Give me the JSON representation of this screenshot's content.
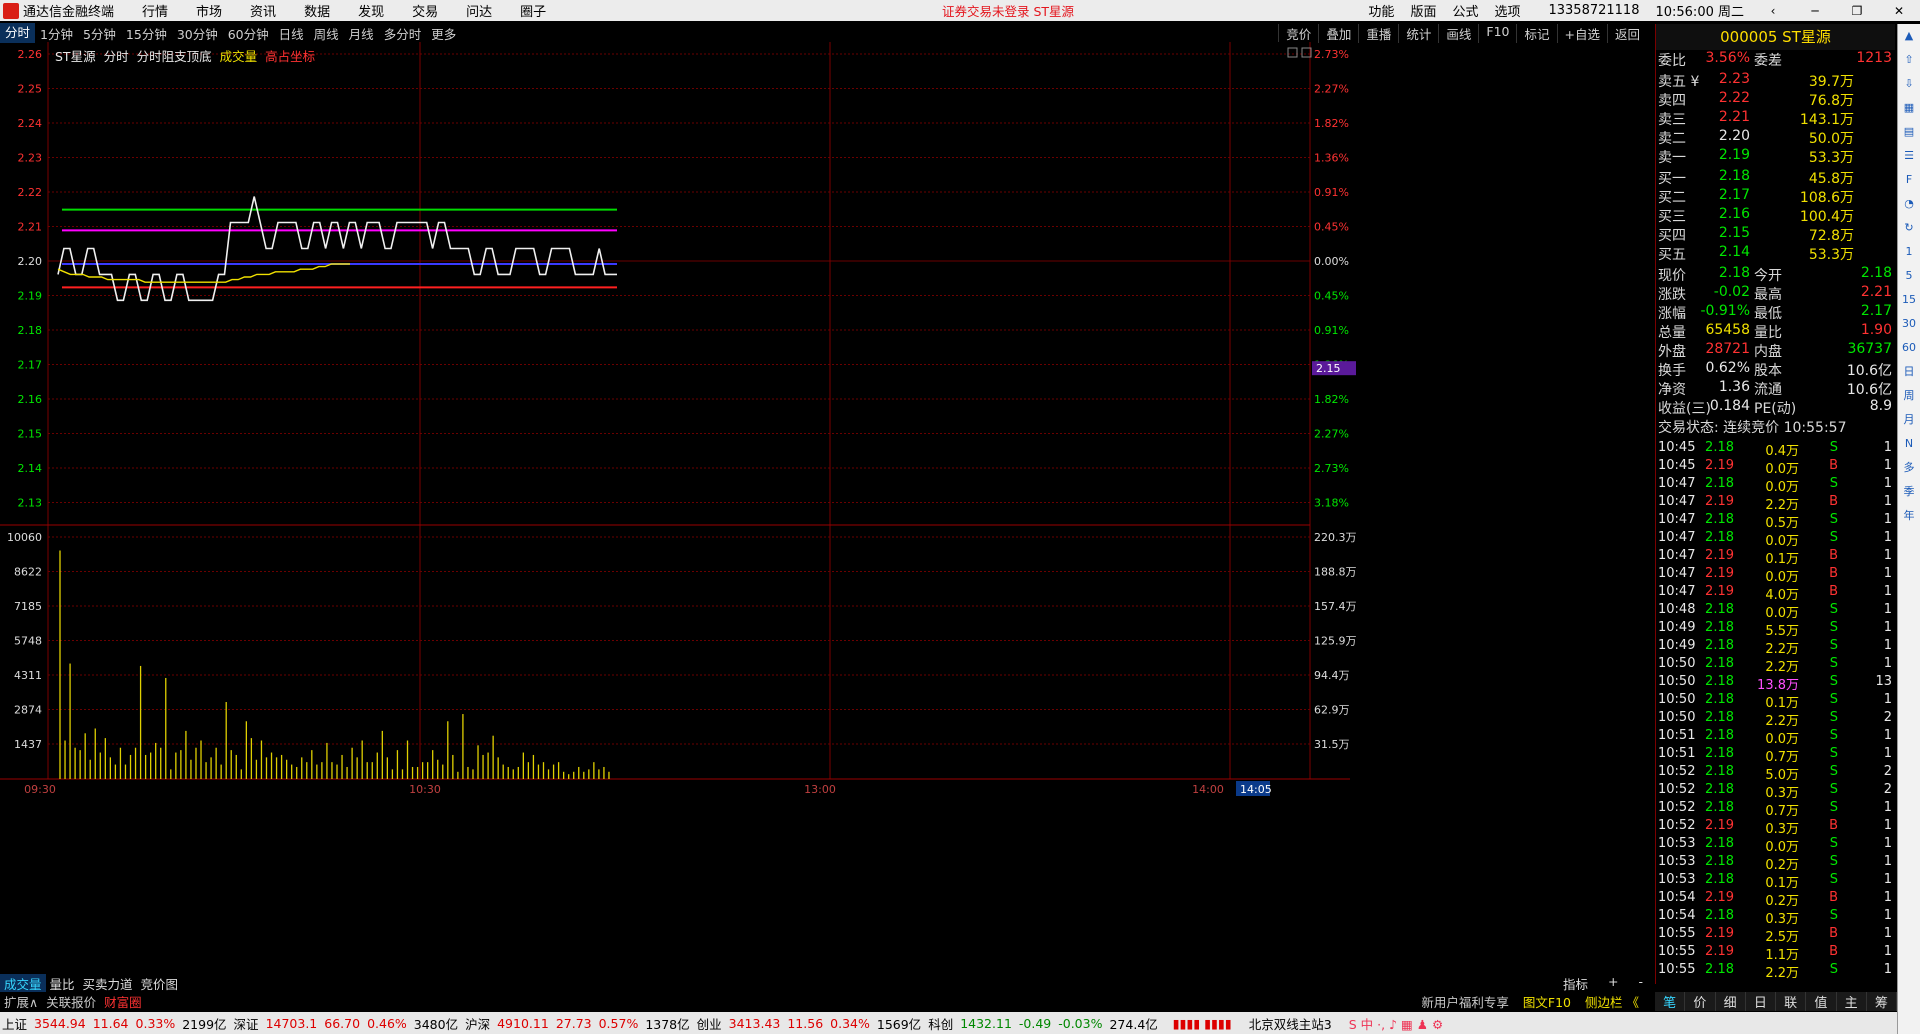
{
  "menubar": {
    "app_name": "通达信金融终端",
    "items": [
      "行情",
      "市场",
      "资讯",
      "数据",
      "发现",
      "交易",
      "问达",
      "圈子"
    ],
    "notice": "证券交易未登录 ST星源",
    "right": [
      "功能",
      "版面",
      "公式",
      "选项"
    ],
    "phone": "13358721118",
    "time": "10:56:00 周二"
  },
  "tabs": [
    "分时",
    "1分钟",
    "5分钟",
    "15分钟",
    "30分钟",
    "60分钟",
    "日线",
    "周线",
    "月线",
    "多分时",
    "更多"
  ],
  "tabs_right": [
    "竞价",
    "叠加",
    "重播",
    "统计",
    "画线",
    "F10",
    "标记",
    "+自选",
    "返回"
  ],
  "info": {
    "name": "ST星源",
    "items": [
      "分时",
      "分时阻支顶底",
      "成交量",
      "高占坐标"
    ]
  },
  "chart_data": {
    "type": "line",
    "title": "ST星源 分时",
    "price_ticks": [
      "2.26",
      "2.25",
      "2.24",
      "2.23",
      "2.22",
      "2.21",
      "2.20",
      "2.19",
      "2.18",
      "2.17",
      "2.16",
      "2.15",
      "2.14",
      "2.13"
    ],
    "pct_ticks": [
      "2.73%",
      "2.27%",
      "1.82%",
      "1.36%",
      "0.91%",
      "0.45%",
      "0.00%",
      "0.45%",
      "0.91%",
      "1.36%",
      "1.82%",
      "2.27%",
      "2.73%",
      "3.18%"
    ],
    "vol_ticks_left": [
      "10060",
      "8622",
      "7185",
      "5748",
      "4311",
      "2874",
      "1437"
    ],
    "vol_ticks_right": [
      "220.3万",
      "188.8万",
      "157.4万",
      "125.9万",
      "94.4万",
      "62.9万",
      "31.5万"
    ],
    "x_ticks": [
      "09:30",
      "10:30",
      "13:00",
      "14:00",
      "14:05"
    ],
    "cursor_price": "2.15",
    "ylim": [
      2.12,
      2.26
    ],
    "levels": {
      "green": 2.205,
      "magenta": 2.197,
      "blue": 2.184,
      "red": 2.175
    },
    "price_series": [
      2.18,
      2.19,
      2.19,
      2.18,
      2.18,
      2.19,
      2.19,
      2.18,
      2.18,
      2.18,
      2.17,
      2.17,
      2.18,
      2.18,
      2.17,
      2.17,
      2.18,
      2.18,
      2.17,
      2.17,
      2.18,
      2.18,
      2.17,
      2.17,
      2.17,
      2.17,
      2.17,
      2.18,
      2.18,
      2.2,
      2.2,
      2.2,
      2.2,
      2.21,
      2.2,
      2.19,
      2.19,
      2.2,
      2.2,
      2.2,
      2.2,
      2.19,
      2.19,
      2.2,
      2.2,
      2.19,
      2.2,
      2.2,
      2.19,
      2.2,
      2.2,
      2.19,
      2.2,
      2.2,
      2.2,
      2.19,
      2.19,
      2.2,
      2.2,
      2.2,
      2.2,
      2.2,
      2.2,
      2.19,
      2.2,
      2.2,
      2.19,
      2.19,
      2.19,
      2.19,
      2.18,
      2.18,
      2.19,
      2.19,
      2.18,
      2.18,
      2.18,
      2.19,
      2.19,
      2.19,
      2.19,
      2.18,
      2.18,
      2.19,
      2.19,
      2.19,
      2.19,
      2.18,
      2.18,
      2.18,
      2.18,
      2.19,
      2.18,
      2.18,
      2.18
    ],
    "avg_series": [
      2.182,
      2.181,
      2.18,
      2.18,
      2.18,
      2.179,
      2.179,
      2.179,
      2.178,
      2.178,
      2.178,
      2.178,
      2.178,
      2.178,
      2.177,
      2.177,
      2.177,
      2.177,
      2.177,
      2.177,
      2.177,
      2.177,
      2.177,
      2.177,
      2.177,
      2.177,
      2.177,
      2.177,
      2.178,
      2.178,
      2.179,
      2.179,
      2.18,
      2.18,
      2.18,
      2.181,
      2.181,
      2.181,
      2.181,
      2.182,
      2.182,
      2.182,
      2.183,
      2.183,
      2.184,
      2.184,
      2.184,
      2.184
    ],
    "volume_series": [
      9500,
      1600,
      4800,
      1300,
      1200,
      1900,
      800,
      2100,
      1100,
      1700,
      900,
      600,
      1300,
      600,
      1000,
      1300,
      4700,
      1000,
      1100,
      1500,
      1300,
      4200,
      400,
      1100,
      1200,
      2000,
      800,
      1300,
      1600,
      700,
      900,
      1300,
      600,
      3200,
      1200,
      1000,
      400,
      2400,
      1700,
      800,
      1600,
      900,
      1100,
      900,
      1000,
      800,
      600,
      500,
      900,
      700,
      1200,
      600,
      700,
      1500,
      700,
      600,
      1000,
      500,
      1300,
      900,
      1600,
      700,
      700,
      1100,
      2000,
      900,
      400,
      1200,
      400,
      1600,
      500,
      500,
      700,
      700,
      1200,
      800,
      600,
      2400,
      1000,
      300,
      2700,
      500,
      400,
      1400,
      1000,
      1100,
      1800,
      900,
      600,
      500,
      400,
      500,
      1100,
      700,
      1000,
      600,
      700,
      400,
      600,
      700,
      300,
      200,
      300,
      500,
      300,
      400,
      700,
      400,
      500,
      300
    ]
  },
  "quote": {
    "title": "000005 ST星源",
    "weibi_label": "委比",
    "weibi": "3.56%",
    "weicha_label": "委差",
    "weicha": "1213",
    "asks": [
      {
        "label": "卖五 ¥",
        "price": "2.23",
        "vol": "39.7万"
      },
      {
        "label": "卖四",
        "price": "2.22",
        "vol": "76.8万"
      },
      {
        "label": "卖三",
        "price": "2.21",
        "vol": "143.1万"
      },
      {
        "label": "卖二",
        "price": "2.20",
        "vol": "50.0万"
      },
      {
        "label": "卖一",
        "price": "2.19",
        "vol": "53.3万"
      }
    ],
    "bids": [
      {
        "label": "买一",
        "price": "2.18",
        "vol": "45.8万"
      },
      {
        "label": "买二",
        "price": "2.17",
        "vol": "108.6万"
      },
      {
        "label": "买三",
        "price": "2.16",
        "vol": "100.4万"
      },
      {
        "label": "买四",
        "price": "2.15",
        "vol": "72.8万"
      },
      {
        "label": "买五",
        "price": "2.14",
        "vol": "53.3万"
      }
    ],
    "stats": [
      {
        "l1": "现价",
        "v1": "2.18",
        "c1": "green",
        "l2": "今开",
        "v2": "2.18",
        "c2": "green"
      },
      {
        "l1": "涨跌",
        "v1": "-0.02",
        "c1": "green",
        "l2": "最高",
        "v2": "2.21",
        "c2": "red"
      },
      {
        "l1": "涨幅",
        "v1": "-0.91%",
        "c1": "green",
        "l2": "最低",
        "v2": "2.17",
        "c2": "green"
      },
      {
        "l1": "总量",
        "v1": "65458",
        "c1": "yellow",
        "l2": "量比",
        "v2": "1.90",
        "c2": "red"
      },
      {
        "l1": "外盘",
        "v1": "28721",
        "c1": "red",
        "l2": "内盘",
        "v2": "36737",
        "c2": "green"
      },
      {
        "l1": "换手",
        "v1": "0.62%",
        "c1": "white",
        "l2": "股本",
        "v2": "10.6亿",
        "c2": "white"
      },
      {
        "l1": "净资",
        "v1": "1.36",
        "c1": "white",
        "l2": "流通",
        "v2": "10.6亿",
        "c2": "white"
      },
      {
        "l1": "收益(三)",
        "v1": "0.184",
        "c1": "white",
        "l2": "PE(动)",
        "v2": "8.9",
        "c2": "white"
      }
    ],
    "trade_status": "交易状态: 连续竞价 10:55:57",
    "ticks": [
      [
        "10:45",
        "2.18",
        "0.4万",
        "S",
        "1"
      ],
      [
        "10:45",
        "2.19",
        "0.0万",
        "B",
        "1"
      ],
      [
        "10:47",
        "2.18",
        "0.0万",
        "S",
        "1"
      ],
      [
        "10:47",
        "2.19",
        "2.2万",
        "B",
        "1"
      ],
      [
        "10:47",
        "2.18",
        "0.5万",
        "S",
        "1"
      ],
      [
        "10:47",
        "2.18",
        "0.0万",
        "S",
        "1"
      ],
      [
        "10:47",
        "2.19",
        "0.1万",
        "B",
        "1"
      ],
      [
        "10:47",
        "2.19",
        "0.0万",
        "B",
        "1"
      ],
      [
        "10:47",
        "2.19",
        "4.0万",
        "B",
        "1"
      ],
      [
        "10:48",
        "2.18",
        "0.0万",
        "S",
        "1"
      ],
      [
        "10:49",
        "2.18",
        "5.5万",
        "S",
        "1"
      ],
      [
        "10:49",
        "2.18",
        "2.2万",
        "S",
        "1"
      ],
      [
        "10:50",
        "2.18",
        "2.2万",
        "S",
        "1"
      ],
      [
        "10:50",
        "2.18",
        "13.8万",
        "S",
        "13"
      ],
      [
        "10:50",
        "2.18",
        "0.1万",
        "S",
        "1"
      ],
      [
        "10:50",
        "2.18",
        "2.2万",
        "S",
        "2"
      ],
      [
        "10:51",
        "2.18",
        "0.0万",
        "S",
        "1"
      ],
      [
        "10:51",
        "2.18",
        "0.7万",
        "S",
        "1"
      ],
      [
        "10:52",
        "2.18",
        "5.0万",
        "S",
        "2"
      ],
      [
        "10:52",
        "2.18",
        "0.3万",
        "S",
        "2"
      ],
      [
        "10:52",
        "2.18",
        "0.7万",
        "S",
        "1"
      ],
      [
        "10:52",
        "2.19",
        "0.3万",
        "B",
        "1"
      ],
      [
        "10:53",
        "2.18",
        "0.0万",
        "S",
        "1"
      ],
      [
        "10:53",
        "2.18",
        "0.2万",
        "S",
        "1"
      ],
      [
        "10:53",
        "2.18",
        "0.1万",
        "S",
        "1"
      ],
      [
        "10:54",
        "2.19",
        "0.2万",
        "B",
        "1"
      ],
      [
        "10:54",
        "2.18",
        "0.3万",
        "S",
        "1"
      ],
      [
        "10:55",
        "2.19",
        "2.5万",
        "B",
        "1"
      ],
      [
        "10:55",
        "2.19",
        "1.1万",
        "B",
        "1"
      ],
      [
        "10:55",
        "2.18",
        "2.2万",
        "S",
        "1"
      ]
    ]
  },
  "right_tabs": [
    "笔",
    "价",
    "细",
    "日",
    "联",
    "值",
    "主",
    "筹"
  ],
  "sidebar_icons": [
    "up-arrow",
    "down-arrow",
    "grid",
    "chart",
    "list",
    "f10",
    "pie",
    "refresh"
  ],
  "sidebar_labels": [
    "1",
    "5",
    "15",
    "30",
    "60",
    "日",
    "周",
    "月",
    "N",
    "多",
    "季",
    "年"
  ],
  "bottom_tabs": [
    "成交量",
    "量比",
    "买卖力道",
    "竞价图"
  ],
  "bottom_right": [
    "指标",
    "+",
    "-"
  ],
  "status2": [
    "扩展∧",
    "关联报价",
    "财富圈"
  ],
  "status2_right": [
    "新用户福利专享",
    "图文F10",
    "侧边栏 《"
  ],
  "indices": [
    {
      "name": "上证",
      "value": "3544.94",
      "chg": "11.64",
      "pct": "0.33%",
      "amt": "2199亿"
    },
    {
      "name": "深证",
      "value": "14703.1",
      "chg": "66.70",
      "pct": "0.46%",
      "amt": "3480亿"
    },
    {
      "name": "沪深",
      "value": "4910.11",
      "chg": "27.73",
      "pct": "0.57%",
      "amt": "1378亿"
    },
    {
      "name": "创业",
      "value": "3413.43",
      "chg": "11.56",
      "pct": "0.34%",
      "amt": "1569亿"
    },
    {
      "name": "科创",
      "value": "1432.11",
      "chg": "-0.49",
      "pct": "-0.03%",
      "amt": "274.4亿"
    }
  ],
  "server": "北京双线主站3"
}
